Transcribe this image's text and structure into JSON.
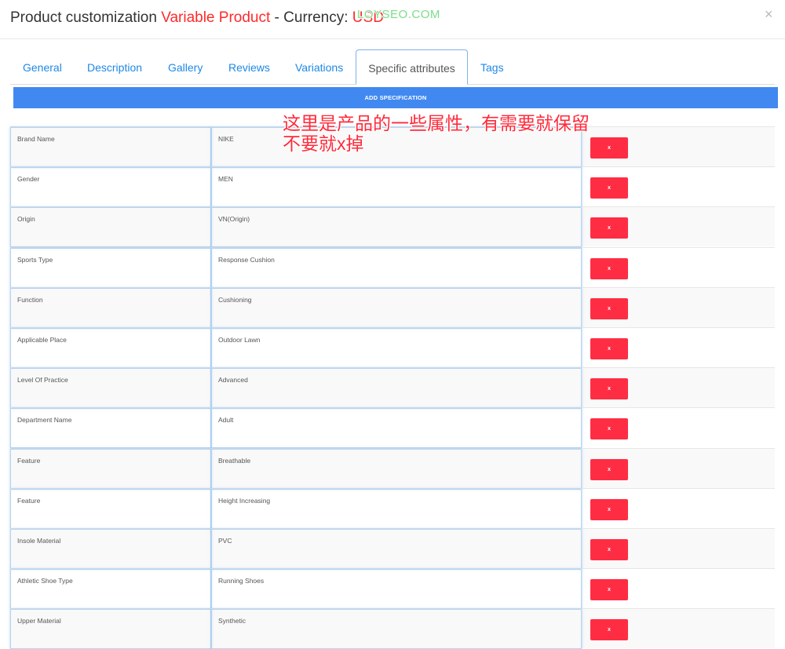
{
  "header": {
    "title_prefix": "Product customization ",
    "title_product": "Variable Product",
    "title_currency_label": " - Currency: ",
    "title_currency": "USD",
    "close_glyph": "×"
  },
  "watermark": "LOYSEO.COM",
  "tabs": [
    {
      "label": "General",
      "active": false
    },
    {
      "label": "Description",
      "active": false
    },
    {
      "label": "Gallery",
      "active": false
    },
    {
      "label": "Reviews",
      "active": false
    },
    {
      "label": "Variations",
      "active": false
    },
    {
      "label": "Specific attributes",
      "active": true
    },
    {
      "label": "Tags",
      "active": false
    }
  ],
  "add_button_label": "ADD SPECIFICATION",
  "delete_label": "x",
  "specs": [
    {
      "name": "Brand Name",
      "value": "NIKE"
    },
    {
      "name": "Gender",
      "value": "MEN"
    },
    {
      "name": "Origin",
      "value": "VN(Origin)"
    },
    {
      "name": "Sports Type",
      "value": "Response Cushion"
    },
    {
      "name": "Function",
      "value": "Cushioning"
    },
    {
      "name": "Applicable Place",
      "value": "Outdoor Lawn"
    },
    {
      "name": "Level Of Practice",
      "value": "Advanced"
    },
    {
      "name": "Department Name",
      "value": "Adult"
    },
    {
      "name": "Feature",
      "value": "Breathable"
    },
    {
      "name": "Feature",
      "value": "Height Increasing"
    },
    {
      "name": "Insole Material",
      "value": "PVC"
    },
    {
      "name": "Athletic Shoe Type",
      "value": "Running Shoes"
    },
    {
      "name": "Upper Material",
      "value": "Synthetic"
    }
  ],
  "annotation": {
    "line1": "这里是产品的一些属性，有需要就保留",
    "line2": "不要就x掉"
  },
  "colors": {
    "accent_blue": "#4189f1",
    "tab_link": "#1e88e5",
    "delete_red": "#ff2d43",
    "title_red": "#ff2a2a"
  }
}
